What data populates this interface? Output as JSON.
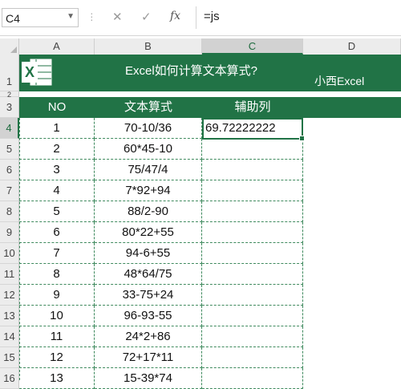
{
  "formula_bar": {
    "name_box": "C4",
    "formula": "=js",
    "cancel_icon": "close-icon",
    "enter_icon": "check-icon",
    "fx_label": "fx"
  },
  "columns": [
    "A",
    "B",
    "C",
    "D"
  ],
  "selected_column": "C",
  "rows": [
    "1",
    "2",
    "3",
    "4",
    "5",
    "6",
    "7",
    "8",
    "9",
    "10",
    "11",
    "12",
    "13",
    "14",
    "15",
    "16"
  ],
  "selected_row": "4",
  "sheet": {
    "title": "Excel如何计算文本算式?",
    "brand": "小西Excel",
    "headers": [
      "NO",
      "文本算式",
      "辅助列"
    ],
    "data": [
      {
        "no": "1",
        "expr": "70-10/36",
        "helper": "69.72222222"
      },
      {
        "no": "2",
        "expr": "60*45-10",
        "helper": ""
      },
      {
        "no": "3",
        "expr": "75/47/4",
        "helper": ""
      },
      {
        "no": "4",
        "expr": "7*92+94",
        "helper": ""
      },
      {
        "no": "5",
        "expr": "88/2-90",
        "helper": ""
      },
      {
        "no": "6",
        "expr": "80*22+55",
        "helper": ""
      },
      {
        "no": "7",
        "expr": "94-6+55",
        "helper": ""
      },
      {
        "no": "8",
        "expr": "48*64/75",
        "helper": ""
      },
      {
        "no": "9",
        "expr": "33-75+24",
        "helper": ""
      },
      {
        "no": "10",
        "expr": "96-93-55",
        "helper": ""
      },
      {
        "no": "11",
        "expr": "24*2+86",
        "helper": ""
      },
      {
        "no": "12",
        "expr": "72+17*11",
        "helper": ""
      },
      {
        "no": "13",
        "expr": "15-39*74",
        "helper": ""
      }
    ]
  },
  "colors": {
    "accent": "#217346",
    "header_bg": "#ececec"
  }
}
